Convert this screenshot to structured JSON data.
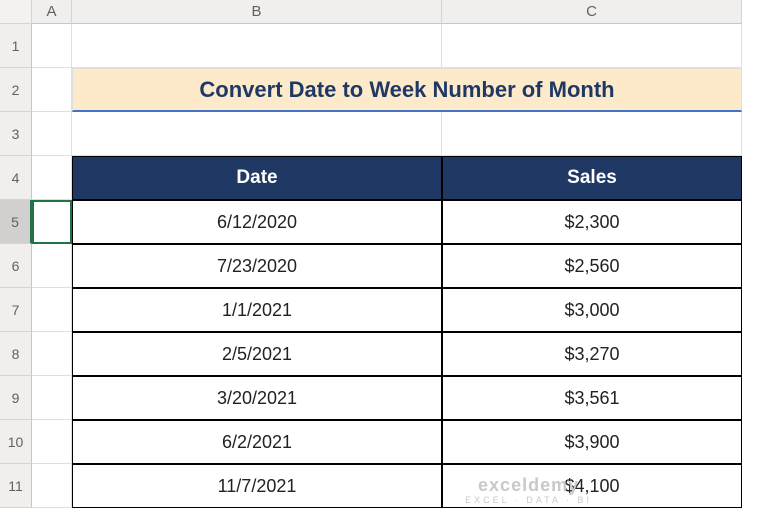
{
  "columns": [
    "A",
    "B",
    "C"
  ],
  "rows": [
    "1",
    "2",
    "3",
    "4",
    "5",
    "6",
    "7",
    "8",
    "9",
    "10",
    "11"
  ],
  "selected_row": "5",
  "title": "Convert Date to Week Number of Month",
  "headers": {
    "date": "Date",
    "sales": "Sales"
  },
  "data": [
    {
      "date": "6/12/2020",
      "sales": "$2,300"
    },
    {
      "date": "7/23/2020",
      "sales": "$2,560"
    },
    {
      "date": "1/1/2021",
      "sales": "$3,000"
    },
    {
      "date": "2/5/2021",
      "sales": "$3,270"
    },
    {
      "date": "3/20/2021",
      "sales": "$3,561"
    },
    {
      "date": "6/2/2021",
      "sales": "$3,900"
    },
    {
      "date": "11/7/2021",
      "sales": "$4,100"
    }
  ],
  "watermark": {
    "main": "exceldemy",
    "sub": "EXCEL · DATA · BI"
  }
}
